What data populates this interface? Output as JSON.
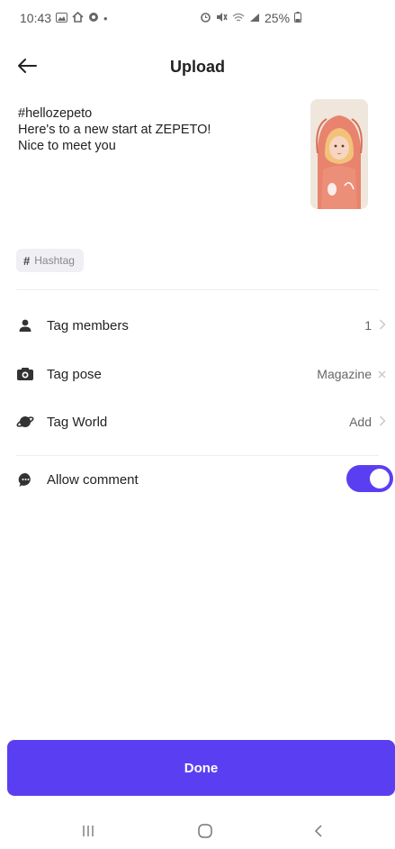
{
  "status_bar": {
    "time": "10:43",
    "left_icons": [
      "gallery-icon",
      "home-icon",
      "settings-icon",
      "dot-icon"
    ],
    "right_icons": [
      "alarm-icon",
      "mute-icon",
      "wifi-icon",
      "signal-icon",
      "battery-icon"
    ],
    "battery": "25%"
  },
  "header": {
    "title": "Upload",
    "back_icon": "arrow-left-icon"
  },
  "caption": {
    "text": "#hellozepeto\nHere's to a new start at ZEPETO!\nNice to meet you"
  },
  "thumbnail": {
    "description_icon": "avatar-image"
  },
  "hashtag_chip": {
    "label": "Hashtag",
    "icon": "hash-icon"
  },
  "rows": [
    {
      "icon": "person-icon",
      "label": "Tag members",
      "value": "1",
      "trail": "chevron-right-icon"
    },
    {
      "icon": "pose-icon",
      "label": "Tag pose",
      "value": "Magazine",
      "trail": "close-icon"
    },
    {
      "icon": "planet-icon",
      "label": "Tag World",
      "value": "Add",
      "trail": "chevron-right-icon"
    },
    {
      "icon": "comment-icon",
      "label": "Allow comment",
      "toggle": true
    }
  ],
  "done_button": {
    "label": "Done"
  },
  "colors": {
    "accent": "#5a3ff2",
    "chip_bg": "#f0f0f4",
    "divider": "#eeeeee"
  },
  "nav_bar": {
    "icons": [
      "recents-icon",
      "home-circle-icon",
      "back-chevron-icon"
    ]
  }
}
